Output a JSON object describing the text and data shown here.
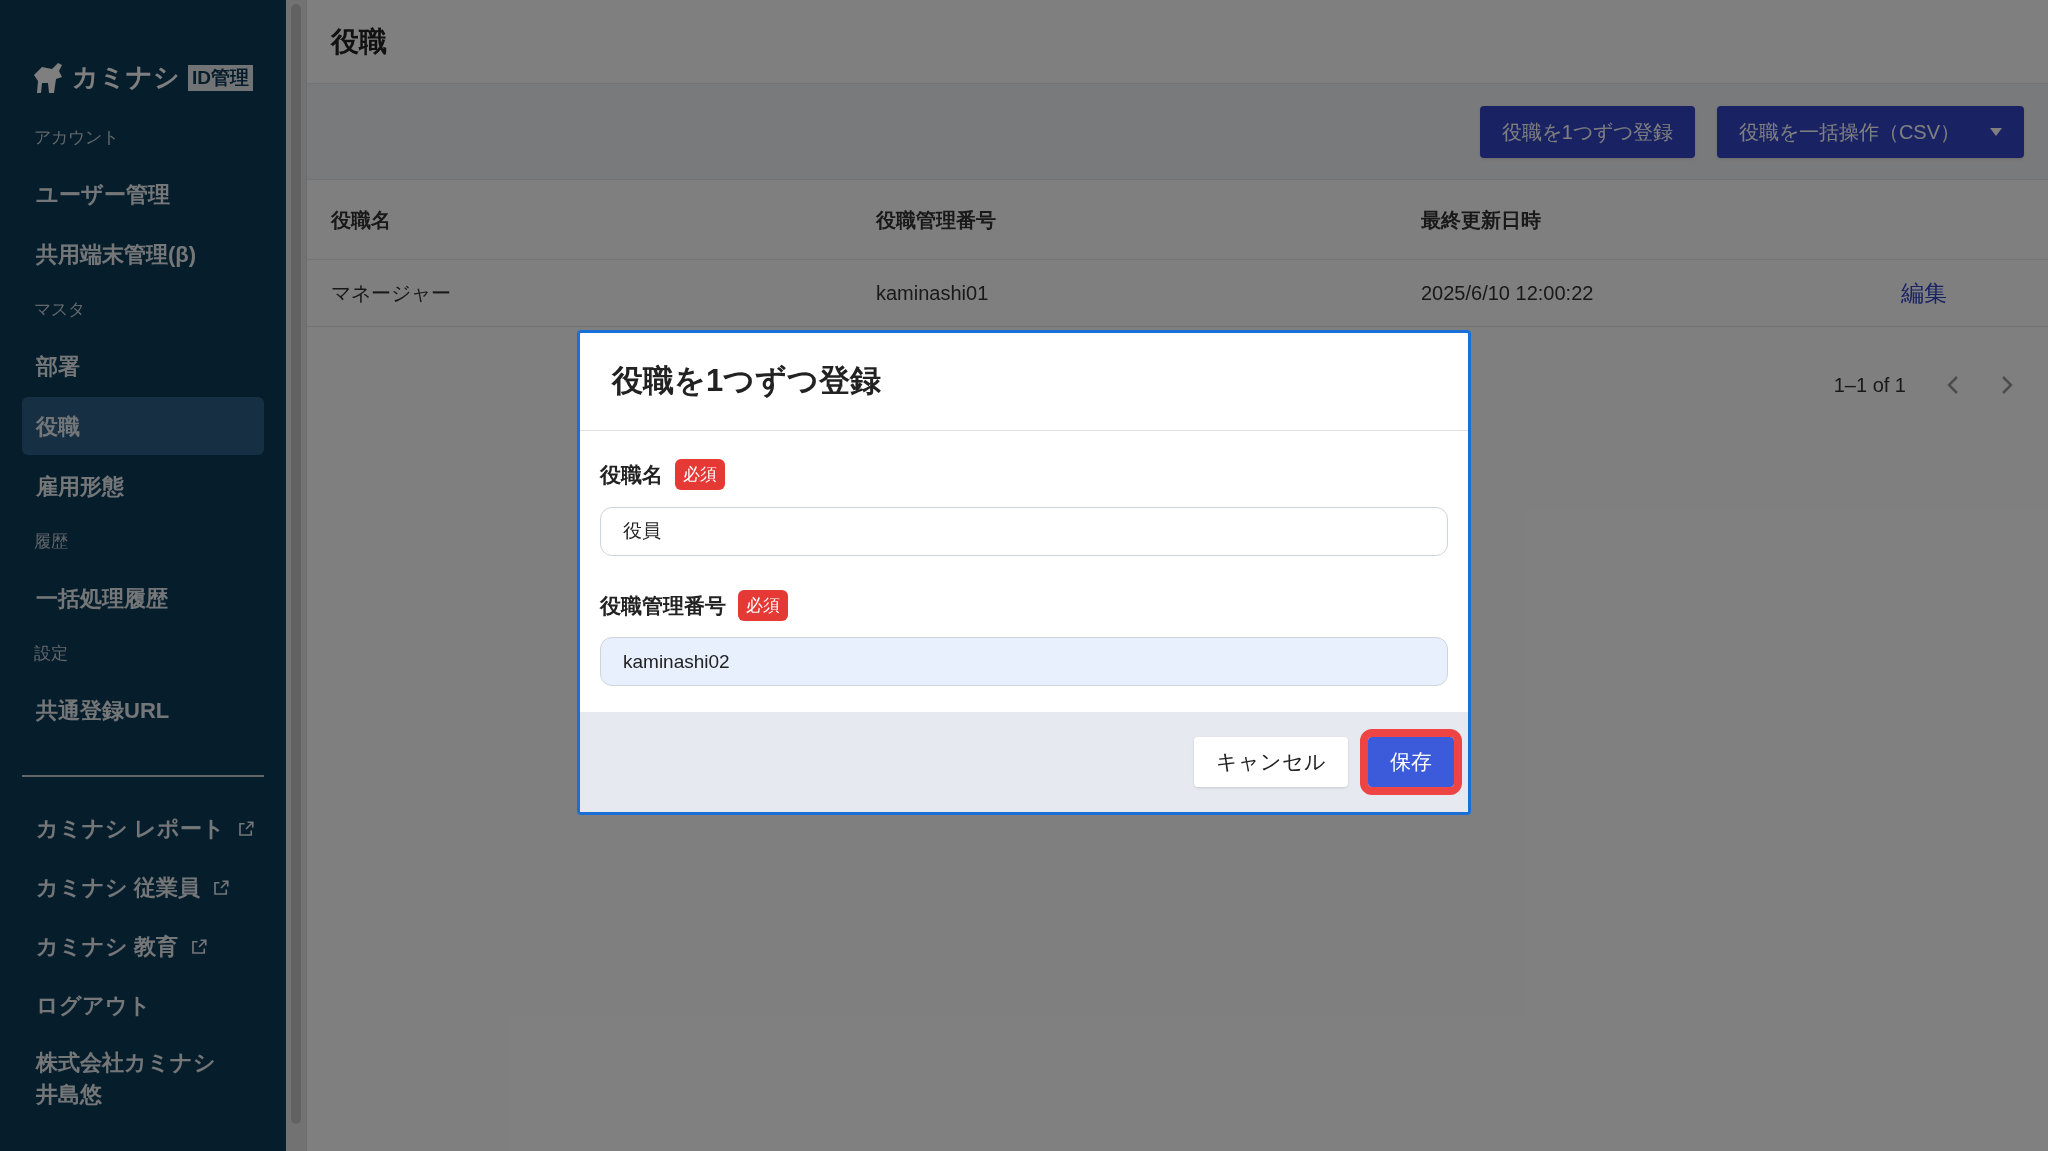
{
  "logo": {
    "name": "カミナシ",
    "badge": "ID管理"
  },
  "sidebar": {
    "sections": [
      {
        "label": "アカウント",
        "items": [
          {
            "label": "ユーザー管理",
            "selected": false
          },
          {
            "label": "共用端末管理(β)",
            "selected": false
          }
        ]
      },
      {
        "label": "マスタ",
        "items": [
          {
            "label": "部署",
            "selected": false
          },
          {
            "label": "役職",
            "selected": true
          },
          {
            "label": "雇用形態",
            "selected": false
          }
        ]
      },
      {
        "label": "履歴",
        "items": [
          {
            "label": "一括処理履歴",
            "selected": false
          }
        ]
      },
      {
        "label": "設定",
        "items": [
          {
            "label": "共通登録URL",
            "selected": false
          }
        ]
      }
    ],
    "links": [
      {
        "label": "カミナシ レポート",
        "kind": "external"
      },
      {
        "label": "カミナシ 従業員",
        "kind": "external"
      },
      {
        "label": "カミナシ 教育",
        "kind": "external"
      },
      {
        "label": "ログアウト",
        "kind": "plain"
      }
    ],
    "company": "株式会社カミナシ",
    "user": "井島悠"
  },
  "page": {
    "title": "役職"
  },
  "toolbar": {
    "buttons": [
      {
        "label": "役職を1つずつ登録",
        "kind": "plain"
      },
      {
        "label": "役職を一括操作（CSV）",
        "kind": "dropdown"
      }
    ]
  },
  "table": {
    "columns": [
      "役職名",
      "役職管理番号",
      "最終更新日時"
    ],
    "rows": [
      {
        "cells": [
          "マネージャー",
          "kaminashi01",
          "2025/6/10 12:00:22"
        ],
        "action": "編集"
      }
    ]
  },
  "pagination": {
    "range": "1–1 of 1"
  },
  "dialog": {
    "title": "役職を1つずつ登録",
    "fields": [
      {
        "label": "役職名",
        "badge": "必須",
        "value": "役員",
        "autofilled": false
      },
      {
        "label": "役職管理番号",
        "badge": "必須",
        "value": "kaminashi02",
        "autofilled": true
      }
    ],
    "buttons": [
      {
        "label": "キャンセル",
        "kind": "secondary",
        "highlighted": false
      },
      {
        "label": "保存",
        "kind": "primary",
        "highlighted": true
      }
    ]
  }
}
